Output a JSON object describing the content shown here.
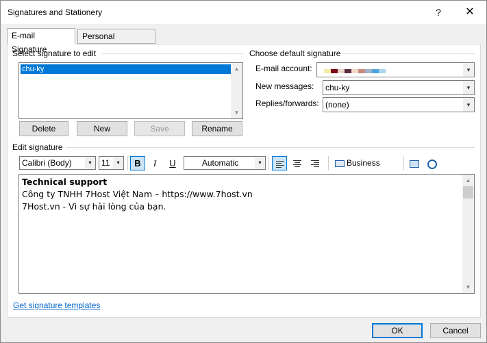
{
  "window": {
    "title": "Signatures and Stationery",
    "help_glyph": "?",
    "close_glyph": "✕"
  },
  "tabs": [
    {
      "label": "E-mail Signature",
      "active": true
    },
    {
      "label": "Personal Stationery",
      "active": false
    }
  ],
  "select_signature": {
    "group_label": "Select signature to edit",
    "items": [
      "chu-ky"
    ],
    "selected": "chu-ky",
    "buttons": {
      "delete": "Delete",
      "new": "New",
      "save": "Save",
      "rename": "Rename"
    }
  },
  "default_signature": {
    "group_label": "Choose default signature",
    "email_account_label": "E-mail account:",
    "new_messages_label": "New messages:",
    "new_messages_value": "chu-ky",
    "replies_label": "Replies/forwards:",
    "replies_value": "(none)",
    "masked_colors": [
      "#f3eaa6",
      "#7a0a1a",
      "#e8d3c5",
      "#5a2b3a",
      "#f2d8c9",
      "#c98b7a",
      "#9fb3c9",
      "#4ea6dc",
      "#a9d6f0"
    ]
  },
  "edit_signature": {
    "group_label": "Edit signature",
    "font": "Calibri (Body)",
    "size": "11",
    "bold_glyph": "B",
    "italic_glyph": "I",
    "underline_glyph": "U",
    "color": "Automatic",
    "business_card_label": "Business Card",
    "lines": [
      "Technical support",
      "Công ty TNHH 7Host Việt Nam – https://www.7host.vn",
      "7Host.vn - Vì sự hài lòng của bạn."
    ]
  },
  "footer": {
    "templates_link": "Get signature templates",
    "ok": "OK",
    "cancel": "Cancel"
  },
  "colors": {
    "selection": "#0078d7",
    "link": "#0066cc",
    "default_button_border": "#0078d7"
  }
}
